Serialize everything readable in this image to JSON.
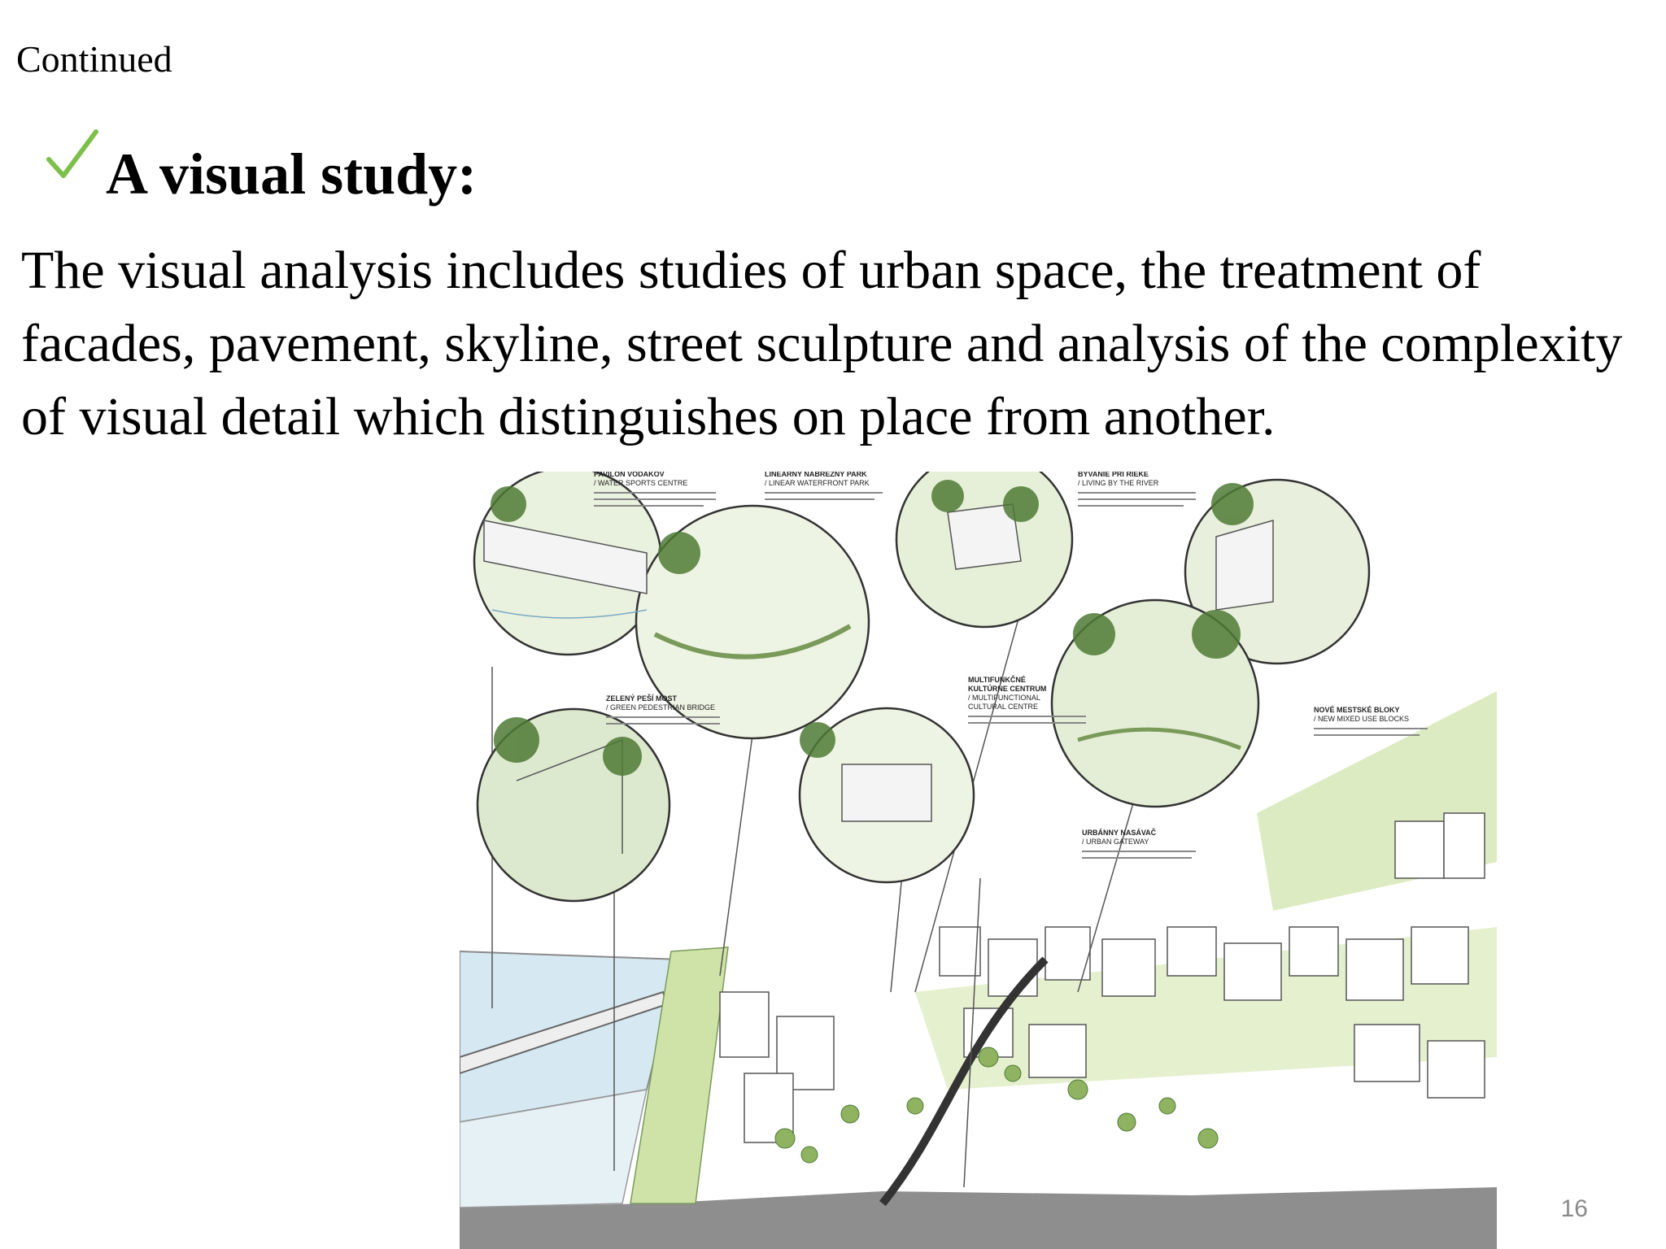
{
  "slide": {
    "continued": "Continued",
    "heading": "A visual study:",
    "body": "The visual analysis includes studies of urban space, the treatment of facades, pavement, skyline, street sculpture and analysis of the complexity of visual detail which distinguishes on place from another.",
    "page_number": "16"
  },
  "illustration": {
    "labels": {
      "water_sports_title": "PAVILÓN VODÁKOV",
      "water_sports_sub": "/ WATER SPORTS CENTRE",
      "waterfront_park_title": "LINEÁRNY NÁBREŽNÝ PARK",
      "waterfront_park_sub": "/ LINEAR WATERFRONT PARK",
      "living_river_title": "BÝVANIE PRI RIEKE",
      "living_river_sub": "/ LIVING BY THE RIVER",
      "bridge_title": "ZELENÝ PEŠÍ MOST",
      "bridge_sub": "/ GREEN PEDESTRIAN BRIDGE",
      "cultural_title_1": "MULTIFUNKČNÉ",
      "cultural_title_2": "KULTÚRNE CENTRUM",
      "cultural_sub_1": "/ MULTIFUNCTIONAL",
      "cultural_sub_2": "CULTURAL CENTRE",
      "mixed_use_title": "NOVÉ MESTSKÉ BLOKY",
      "mixed_use_sub": "/ NEW MIXED USE BLOCKS",
      "gateway_title": "URBÁNNY NASÁVAČ",
      "gateway_sub": "/ URBAN GATEWAY"
    }
  },
  "colors": {
    "check": "#7cc04b",
    "accent_green": "#4f7a35",
    "light_green": "#cfe3a8",
    "water": "#d6e9f2",
    "ground": "#8e8e8e"
  }
}
